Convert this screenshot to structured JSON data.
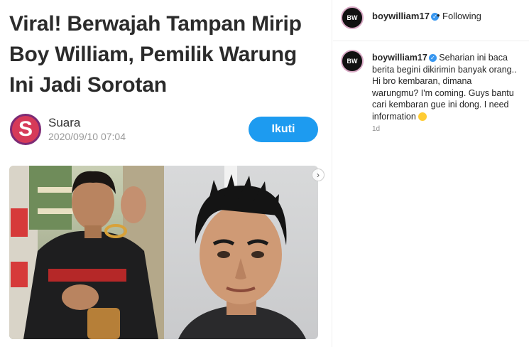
{
  "article": {
    "headline": "Viral! Berwajah Tampan Mirip Boy William, Pemilik Warung Ini Jadi Sorotan",
    "publisher": "Suara",
    "publisher_logo_letter": "S",
    "timestamp": "2020/09/10 07:04",
    "follow_label": "Ikuti"
  },
  "post": {
    "username": "boywilliam17",
    "follow_status": "Following",
    "separator": "•",
    "verified_glyph": "✓",
    "avatar_text": "BW",
    "caption": "Seharian ini baca berita begini dikirimin banyak orang.. Hi bro kembaran, dimana warungmu? I'm coming. Guys bantu cari kembaran gue ini dong. I need information",
    "age": "1d"
  },
  "colors": {
    "accent": "#1d9bf0",
    "verified": "#3897f0",
    "publisher_logo": "#d63a59"
  },
  "icons": {
    "verified": "verified-badge-icon",
    "next": "chevron-right-icon",
    "emoji": "grinning-face-icon"
  },
  "carousel": {
    "next_glyph": "›"
  }
}
